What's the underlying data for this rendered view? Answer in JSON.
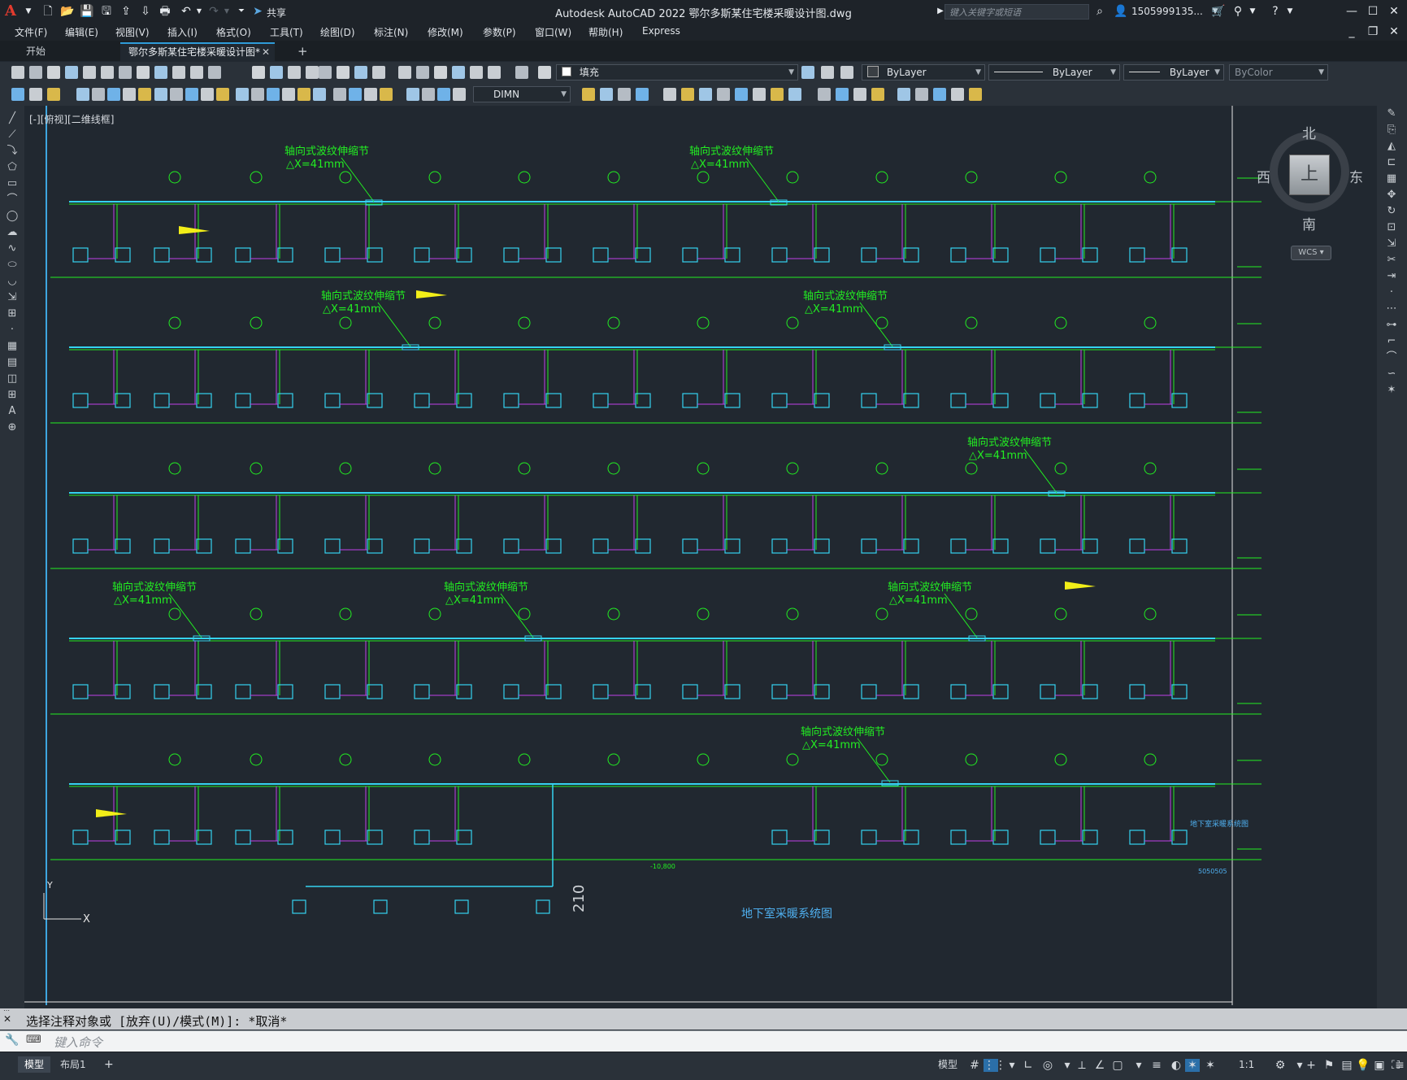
{
  "app": {
    "title": "Autodesk AutoCAD 2022    鄂尔多斯某住宅楼采暖设计图.dwg",
    "logo": "A",
    "share_label": "共享",
    "search_placeholder": "键入关键字或短语",
    "user": "1505999135...",
    "window_buttons": [
      "minimize-icon",
      "maximize-icon",
      "close-icon"
    ]
  },
  "menu": [
    "文件(F)",
    "编辑(E)",
    "视图(V)",
    "插入(I)",
    "格式(O)",
    "工具(T)",
    "绘图(D)",
    "标注(N)",
    "修改(M)",
    "参数(P)",
    "窗口(W)",
    "帮助(H)",
    "Express"
  ],
  "tabs": {
    "start": "开始",
    "document": "鄂尔多斯某住宅楼采暖设计图*",
    "new_tab": "+"
  },
  "properties": {
    "layer": "填充",
    "color": "ByLayer",
    "linetype": "ByLayer",
    "lineweight": "ByLayer",
    "plotstyle": "ByColor",
    "dimstyle": "DIMN"
  },
  "viewport": {
    "label": "[-][俯视][二维线框]",
    "viewcube": {
      "north": "北",
      "south": "南",
      "east": "东",
      "west": "西",
      "top": "上",
      "wcs": "WCS"
    }
  },
  "drawing": {
    "expansion_label": "轴向式波纹伸缩节",
    "delta": "△X=41mm",
    "drawing_title": "地下室采暖系统图",
    "side_title": "地下室采暖系统图",
    "side_code": "5050505",
    "level_label": "-10,800",
    "dim_210": "210",
    "colors": {
      "pipe_cyan": "#35d3f0",
      "annotation_green": "#22ee22",
      "riser_magenta": "#c040e8",
      "marker_yellow": "#f2ee18"
    }
  },
  "command": {
    "history": "选择注释对象或 [放弃(U)/模式(M)]: *取消*",
    "placeholder": "键入命令"
  },
  "status": {
    "model_tab": "模型",
    "layout_tab": "布局1",
    "add_tab": "+",
    "model_space": "模型",
    "scale": "1:1"
  }
}
